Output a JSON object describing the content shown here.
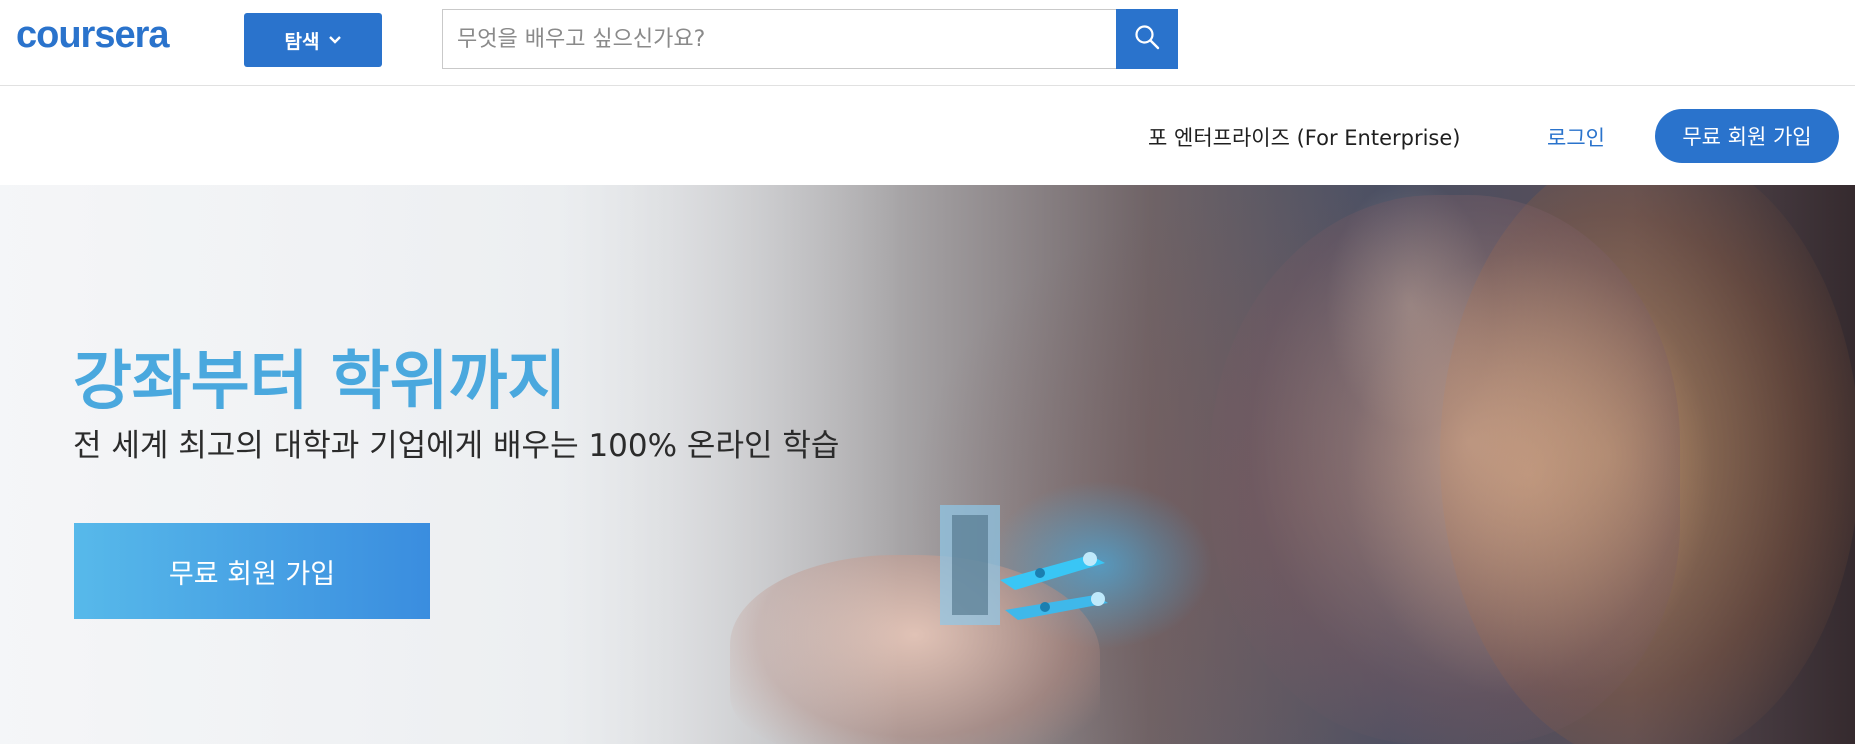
{
  "header": {
    "logo_text": "coursera",
    "explore_label": "탐색",
    "search": {
      "placeholder": "무엇을 배우고 싶으신가요?",
      "value": ""
    }
  },
  "subheader": {
    "enterprise_label": "포 엔터프라이즈 (For Enterprise)",
    "login_label": "로그인",
    "join_label": "무료 회원 가입"
  },
  "hero": {
    "title": "강좌부터 학위까지",
    "subtitle": "전 세계 최고의 대학과 기업에게 배우는 100% 온라인 학습",
    "cta_label": "무료 회원 가입"
  },
  "icons": {
    "explore": "chevron-down-icon",
    "search": "search-icon"
  },
  "colors": {
    "brand": "#2a73cc",
    "hero_title": "#4aa8de",
    "hero_cta_start": "#57b9ea",
    "hero_cta_end": "#3a8ddf"
  }
}
